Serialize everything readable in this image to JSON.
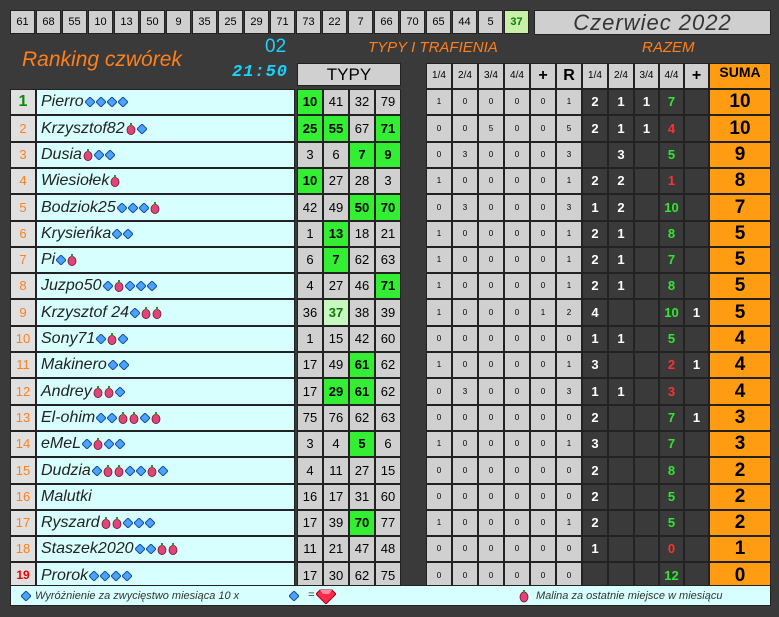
{
  "header": {
    "drawn_numbers": [
      "61",
      "68",
      "55",
      "10",
      "13",
      "50",
      "9",
      "35",
      "25",
      "29",
      "71",
      "73",
      "22",
      "7",
      "66",
      "70",
      "65",
      "44",
      "5",
      "37"
    ],
    "highlight_number": "37",
    "month": "Czerwiec 2022",
    "title": "Ranking czwórek",
    "draw_no": "02",
    "time": "21:50",
    "typy_trafienia": "TYPY I TRAFIENIA",
    "razem": "RAZEM",
    "typy": "TYPY",
    "sub_headers": [
      "1/4",
      "2/4",
      "3/4",
      "4/4",
      "+",
      "R",
      "1/4",
      "2/4",
      "3/4",
      "4/4",
      "+",
      "SUMA"
    ]
  },
  "colors": {
    "orange": "#ff7f1a",
    "cyan": "#19d3ff",
    "hit": "#33ee33",
    "suma": "#ff9c12",
    "name_bg": "#d6fffd"
  },
  "rows": [
    {
      "rank": "1",
      "name": "Pierro",
      "badges": [
        "d",
        "d",
        "d",
        "d"
      ],
      "typy": [
        "10",
        "41",
        "32",
        "79"
      ],
      "hits": [
        1,
        0,
        0,
        0
      ],
      "stats": [
        "1",
        "0",
        "0",
        "0",
        "0",
        "1"
      ],
      "razem": [
        "2",
        "1",
        "1",
        "7",
        ""
      ],
      "rz_colors": [
        "",
        "",
        "",
        "g",
        ""
      ],
      "suma": "10"
    },
    {
      "rank": "2",
      "name": "Krzysztof82",
      "badges": [
        "m",
        "d"
      ],
      "typy": [
        "25",
        "55",
        "67",
        "71"
      ],
      "hits": [
        1,
        1,
        0,
        1
      ],
      "stats": [
        "0",
        "0",
        "5",
        "0",
        "0",
        "5"
      ],
      "razem": [
        "2",
        "1",
        "1",
        "4",
        ""
      ],
      "rz_colors": [
        "",
        "",
        "",
        "r",
        ""
      ],
      "suma": "10"
    },
    {
      "rank": "3",
      "name": "Dusia",
      "badges": [
        "m",
        "d",
        "d"
      ],
      "typy": [
        "3",
        "6",
        "7",
        "9"
      ],
      "hits": [
        0,
        0,
        1,
        1
      ],
      "stats": [
        "0",
        "3",
        "0",
        "0",
        "0",
        "3"
      ],
      "razem": [
        "",
        "3",
        "",
        "5",
        ""
      ],
      "rz_colors": [
        "",
        "",
        "",
        "g",
        ""
      ],
      "suma": "9"
    },
    {
      "rank": "4",
      "name": "Wiesiołek",
      "badges": [
        "m"
      ],
      "typy": [
        "10",
        "27",
        "28",
        "3"
      ],
      "hits": [
        1,
        0,
        0,
        0
      ],
      "stats": [
        "1",
        "0",
        "0",
        "0",
        "0",
        "1"
      ],
      "razem": [
        "2",
        "2",
        "",
        "1",
        ""
      ],
      "rz_colors": [
        "",
        "",
        "",
        "r",
        ""
      ],
      "suma": "8"
    },
    {
      "rank": "5",
      "name": "Bodziok25",
      "badges": [
        "d",
        "d",
        "d",
        "m"
      ],
      "typy": [
        "42",
        "49",
        "50",
        "70"
      ],
      "hits": [
        0,
        0,
        1,
        1
      ],
      "stats": [
        "0",
        "3",
        "0",
        "0",
        "0",
        "3"
      ],
      "razem": [
        "1",
        "2",
        "",
        "10",
        ""
      ],
      "rz_colors": [
        "",
        "",
        "",
        "g",
        ""
      ],
      "suma": "7"
    },
    {
      "rank": "6",
      "name": "Krysieńka",
      "badges": [
        "d",
        "d"
      ],
      "typy": [
        "1",
        "13",
        "18",
        "21"
      ],
      "hits": [
        0,
        1,
        0,
        0
      ],
      "stats": [
        "1",
        "0",
        "0",
        "0",
        "0",
        "1"
      ],
      "razem": [
        "2",
        "1",
        "",
        "8",
        ""
      ],
      "rz_colors": [
        "",
        "",
        "",
        "g",
        ""
      ],
      "suma": "5"
    },
    {
      "rank": "7",
      "name": "Pi",
      "badges": [
        "d",
        "m"
      ],
      "typy": [
        "6",
        "7",
        "62",
        "63"
      ],
      "hits": [
        0,
        1,
        0,
        0
      ],
      "stats": [
        "1",
        "0",
        "0",
        "0",
        "0",
        "1"
      ],
      "razem": [
        "2",
        "1",
        "",
        "7",
        ""
      ],
      "rz_colors": [
        "",
        "",
        "",
        "g",
        ""
      ],
      "suma": "5"
    },
    {
      "rank": "8",
      "name": "Juzpo50",
      "badges": [
        "d",
        "m",
        "d",
        "d",
        "d"
      ],
      "typy": [
        "4",
        "27",
        "46",
        "71"
      ],
      "hits": [
        0,
        0,
        0,
        1
      ],
      "stats": [
        "1",
        "0",
        "0",
        "0",
        "0",
        "1"
      ],
      "razem": [
        "2",
        "1",
        "",
        "8",
        ""
      ],
      "rz_colors": [
        "",
        "",
        "",
        "g",
        ""
      ],
      "suma": "5"
    },
    {
      "rank": "9",
      "name": "Krzysztof 24",
      "badges": [
        "d",
        "m",
        "m"
      ],
      "typy": [
        "36",
        "37",
        "38",
        "39"
      ],
      "hits": [
        0,
        2,
        0,
        0
      ],
      "stats": [
        "1",
        "0",
        "0",
        "0",
        "1",
        "2"
      ],
      "razem": [
        "4",
        "",
        "",
        "10",
        "1"
      ],
      "rz_colors": [
        "",
        "",
        "",
        "g",
        ""
      ],
      "suma": "5"
    },
    {
      "rank": "10",
      "name": "Sony71",
      "badges": [
        "d",
        "m",
        "d"
      ],
      "typy": [
        "1",
        "15",
        "42",
        "60"
      ],
      "hits": [
        0,
        0,
        0,
        0
      ],
      "stats": [
        "0",
        "0",
        "0",
        "0",
        "0",
        "0"
      ],
      "razem": [
        "1",
        "1",
        "",
        "5",
        ""
      ],
      "rz_colors": [
        "",
        "",
        "",
        "g",
        ""
      ],
      "suma": "4"
    },
    {
      "rank": "11",
      "name": "Makinero",
      "badges": [
        "d",
        "d"
      ],
      "typy": [
        "17",
        "49",
        "61",
        "62"
      ],
      "hits": [
        0,
        0,
        1,
        0
      ],
      "stats": [
        "1",
        "0",
        "0",
        "0",
        "0",
        "1"
      ],
      "razem": [
        "3",
        "",
        "",
        "2",
        "1"
      ],
      "rz_colors": [
        "",
        "",
        "",
        "r",
        ""
      ],
      "suma": "4"
    },
    {
      "rank": "12",
      "name": "Andrey",
      "badges": [
        "m",
        "m",
        "d"
      ],
      "typy": [
        "17",
        "29",
        "61",
        "62"
      ],
      "hits": [
        0,
        1,
        1,
        0
      ],
      "stats": [
        "0",
        "3",
        "0",
        "0",
        "0",
        "3"
      ],
      "razem": [
        "1",
        "1",
        "",
        "3",
        ""
      ],
      "rz_colors": [
        "",
        "",
        "",
        "r",
        ""
      ],
      "suma": "4"
    },
    {
      "rank": "13",
      "name": "El-ohim",
      "badges": [
        "d",
        "d",
        "m",
        "m",
        "d",
        "m"
      ],
      "typy": [
        "75",
        "76",
        "62",
        "63"
      ],
      "hits": [
        0,
        0,
        0,
        0
      ],
      "stats": [
        "0",
        "0",
        "0",
        "0",
        "0",
        "0"
      ],
      "razem": [
        "2",
        "",
        "",
        "7",
        "1"
      ],
      "rz_colors": [
        "",
        "",
        "",
        "g",
        ""
      ],
      "suma": "3"
    },
    {
      "rank": "14",
      "name": "eMeL",
      "badges": [
        "d",
        "m",
        "d",
        "d"
      ],
      "typy": [
        "3",
        "4",
        "5",
        "6"
      ],
      "hits": [
        0,
        0,
        1,
        0
      ],
      "stats": [
        "1",
        "0",
        "0",
        "0",
        "0",
        "1"
      ],
      "razem": [
        "3",
        "",
        "",
        "7",
        ""
      ],
      "rz_colors": [
        "",
        "",
        "",
        "g",
        ""
      ],
      "suma": "3"
    },
    {
      "rank": "15",
      "name": "Dudzia",
      "badges": [
        "d",
        "m",
        "m",
        "d",
        "d",
        "m",
        "d"
      ],
      "typy": [
        "4",
        "11",
        "27",
        "15"
      ],
      "hits": [
        0,
        0,
        0,
        0
      ],
      "stats": [
        "0",
        "0",
        "0",
        "0",
        "0",
        "0"
      ],
      "razem": [
        "2",
        "",
        "",
        "8",
        ""
      ],
      "rz_colors": [
        "",
        "",
        "",
        "g",
        ""
      ],
      "suma": "2"
    },
    {
      "rank": "16",
      "name": "Malutki",
      "badges": [],
      "typy": [
        "16",
        "17",
        "31",
        "60"
      ],
      "hits": [
        0,
        0,
        0,
        0
      ],
      "stats": [
        "0",
        "0",
        "0",
        "0",
        "0",
        "0"
      ],
      "razem": [
        "2",
        "",
        "",
        "5",
        ""
      ],
      "rz_colors": [
        "",
        "",
        "",
        "g",
        ""
      ],
      "suma": "2"
    },
    {
      "rank": "17",
      "name": "Ryszard",
      "badges": [
        "m",
        "m",
        "d",
        "d",
        "d"
      ],
      "typy": [
        "17",
        "39",
        "70",
        "77"
      ],
      "hits": [
        0,
        0,
        1,
        0
      ],
      "stats": [
        "1",
        "0",
        "0",
        "0",
        "0",
        "1"
      ],
      "razem": [
        "2",
        "",
        "",
        "5",
        ""
      ],
      "rz_colors": [
        "",
        "",
        "",
        "g",
        ""
      ],
      "suma": "2"
    },
    {
      "rank": "18",
      "name": "Staszek2020",
      "badges": [
        "d",
        "d",
        "m",
        "m"
      ],
      "typy": [
        "11",
        "21",
        "47",
        "48"
      ],
      "hits": [
        0,
        0,
        0,
        0
      ],
      "stats": [
        "0",
        "0",
        "0",
        "0",
        "0",
        "0"
      ],
      "razem": [
        "1",
        "",
        "",
        "0",
        ""
      ],
      "rz_colors": [
        "",
        "",
        "",
        "r",
        ""
      ],
      "suma": "1"
    },
    {
      "rank": "19",
      "name": "Prorok",
      "badges": [
        "d",
        "d",
        "d",
        "d"
      ],
      "typy": [
        "17",
        "30",
        "62",
        "75"
      ],
      "hits": [
        0,
        0,
        0,
        0
      ],
      "stats": [
        "0",
        "0",
        "0",
        "0",
        "0",
        "0"
      ],
      "razem": [
        "",
        "",
        "",
        "12",
        ""
      ],
      "rz_colors": [
        "",
        "",
        "",
        "g",
        ""
      ],
      "suma": "0"
    }
  ],
  "footer": {
    "left_text": "Wyróżnienie za zwycięstwo miesiąca  10 x",
    "equals": "=",
    "right_text": "Malina za ostatnie miejsce w miesiącu"
  }
}
